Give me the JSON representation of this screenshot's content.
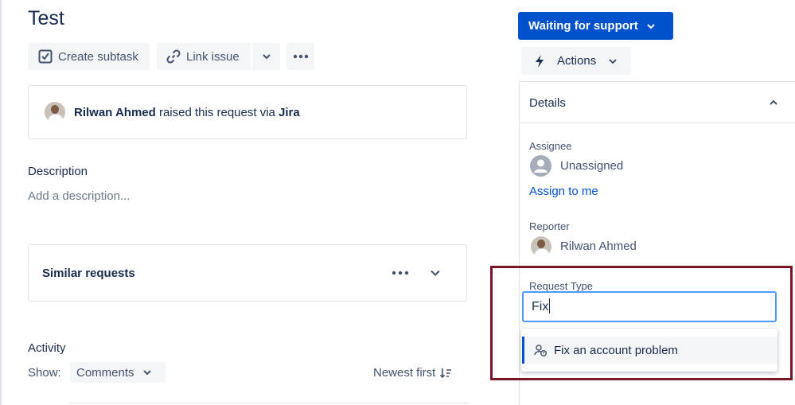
{
  "issue": {
    "title": "Test"
  },
  "toolbar": {
    "create_subtask": "Create subtask",
    "link_issue": "Link issue"
  },
  "raised": {
    "name": "Rilwan Ahmed",
    "middle": " raised this request via ",
    "via": "Jira"
  },
  "description": {
    "heading": "Description",
    "placeholder": "Add a description..."
  },
  "similar": {
    "heading": "Similar requests"
  },
  "activity": {
    "heading": "Activity",
    "show_label": "Show:",
    "filter": "Comments",
    "sort": "Newest first"
  },
  "status": {
    "label": "Waiting for support"
  },
  "actions": {
    "label": "Actions"
  },
  "details": {
    "heading": "Details",
    "assignee_label": "Assignee",
    "assignee_value": "Unassigned",
    "assign_to_me": "Assign to me",
    "reporter_label": "Reporter",
    "reporter_value": "Rilwan Ahmed",
    "request_type_label": "Request Type",
    "request_type_input": "Fix",
    "request_type_option": "Fix an account problem"
  },
  "colors": {
    "primary": "#0052cc",
    "focus": "#4c9aff",
    "highlight": "#7b1427"
  }
}
